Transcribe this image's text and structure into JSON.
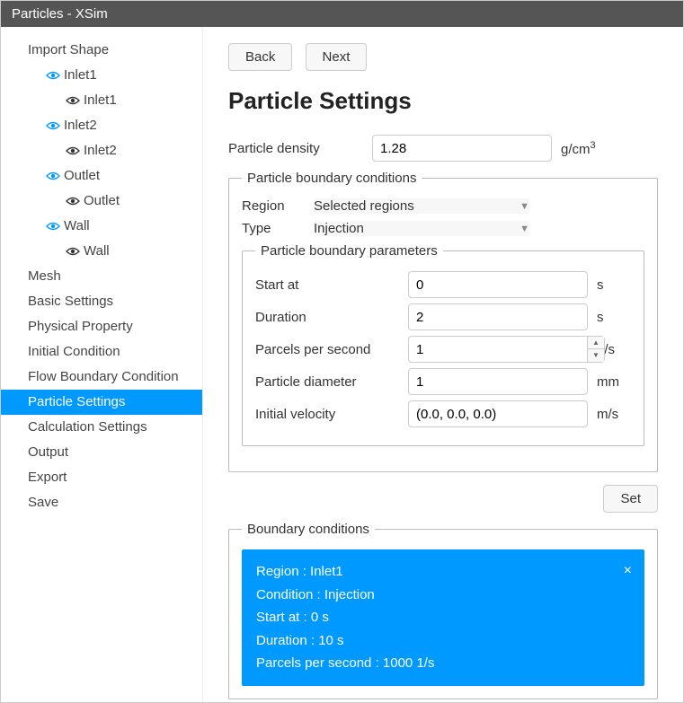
{
  "window": {
    "title": "Particles - XSim"
  },
  "nav": {
    "back": "Back",
    "next": "Next"
  },
  "page": {
    "heading": "Particle Settings"
  },
  "sidebar": {
    "items": [
      {
        "label": "Import Shape",
        "level": 0
      },
      {
        "label": "Inlet1",
        "level": 1,
        "eye": "blue"
      },
      {
        "label": "Inlet1",
        "level": 2,
        "eye": "dark"
      },
      {
        "label": "Inlet2",
        "level": 1,
        "eye": "blue"
      },
      {
        "label": "Inlet2",
        "level": 2,
        "eye": "dark"
      },
      {
        "label": "Outlet",
        "level": 1,
        "eye": "blue"
      },
      {
        "label": "Outlet",
        "level": 2,
        "eye": "dark"
      },
      {
        "label": "Wall",
        "level": 1,
        "eye": "blue"
      },
      {
        "label": "Wall",
        "level": 2,
        "eye": "dark"
      },
      {
        "label": "Mesh",
        "level": 0
      },
      {
        "label": "Basic Settings",
        "level": 0
      },
      {
        "label": "Physical Property",
        "level": 0
      },
      {
        "label": "Initial Condition",
        "level": 0
      },
      {
        "label": "Flow Boundary Condition",
        "level": 0
      },
      {
        "label": "Particle Settings",
        "level": 0,
        "selected": true
      },
      {
        "label": "Calculation Settings",
        "level": 0
      },
      {
        "label": "Output",
        "level": 0
      },
      {
        "label": "Export",
        "level": 0
      },
      {
        "label": "Save",
        "level": 0
      }
    ]
  },
  "density": {
    "label": "Particle density",
    "value": "1.28",
    "unit_prefix": "g/cm",
    "unit_sup": "3"
  },
  "pbc": {
    "legend": "Particle boundary conditions",
    "region_label": "Region",
    "region_value": "Selected regions",
    "type_label": "Type",
    "type_value": "Injection",
    "params_legend": "Particle boundary parameters",
    "start_label": "Start at",
    "start_value": "0",
    "start_unit": "s",
    "duration_label": "Duration",
    "duration_value": "2",
    "duration_unit": "s",
    "pps_label": "Parcels per second",
    "pps_value": "1",
    "pps_unit": "1/s",
    "diameter_label": "Particle diameter",
    "diameter_value": "1",
    "diameter_unit": "mm",
    "velocity_label": "Initial velocity",
    "velocity_value": "(0.0, 0.0, 0.0)",
    "velocity_unit": "m/s"
  },
  "set_button": "Set",
  "bc_list": {
    "legend": "Boundary conditions",
    "card": {
      "line1": "Region : Inlet1",
      "line2": "Condition : Injection",
      "line3": "Start at : 0 s",
      "line4": "Duration : 10 s",
      "line5": "Parcels per second : 1000 1/s"
    }
  }
}
